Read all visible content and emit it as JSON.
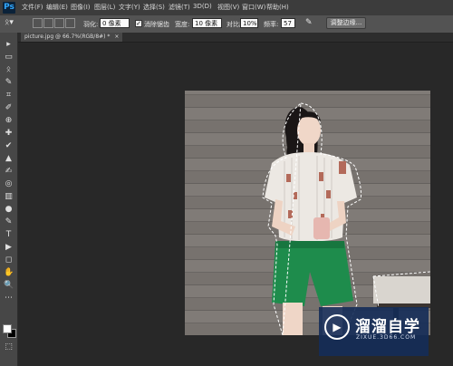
{
  "app": {
    "logo": "Ps"
  },
  "menu": [
    "文件(F)",
    "编辑(E)",
    "图像(I)",
    "图层(L)",
    "文字(Y)",
    "选择(S)",
    "滤镜(T)",
    "3D(D)",
    "视图(V)",
    "窗口(W)",
    "帮助(H)"
  ],
  "options": {
    "feather_label": "羽化:",
    "feather_value": "0 像素",
    "antialias_checked": "✓",
    "antialias_label": "消除锯齿",
    "width_label": "宽度:",
    "width_value": "10 像素",
    "contrast_label": "对比度:",
    "contrast_value": "10%",
    "frequency_label": "频率:",
    "frequency_value": "57",
    "refine_button": "调整边缘..."
  },
  "document": {
    "tab_title": "picture.jpg @ 66.7%(RGB/8#) *",
    "close_glyph": "×"
  },
  "tools": [
    "▸",
    "▭",
    "ᛟ",
    "✎",
    "⌗",
    "✐",
    "⊕",
    "✚",
    "✔",
    "▲",
    "✍",
    "◎",
    "▥",
    "●",
    "✎",
    "T",
    "▶",
    "◻",
    "✋",
    "🔍",
    "⋯",
    "⬚"
  ],
  "colors": {
    "accent": "#31a8ff",
    "watermark": "#142c58"
  },
  "watermark": {
    "name": "溜溜自学",
    "url": "ZIXUE.3D66.COM",
    "logo_glyph": "▶"
  }
}
